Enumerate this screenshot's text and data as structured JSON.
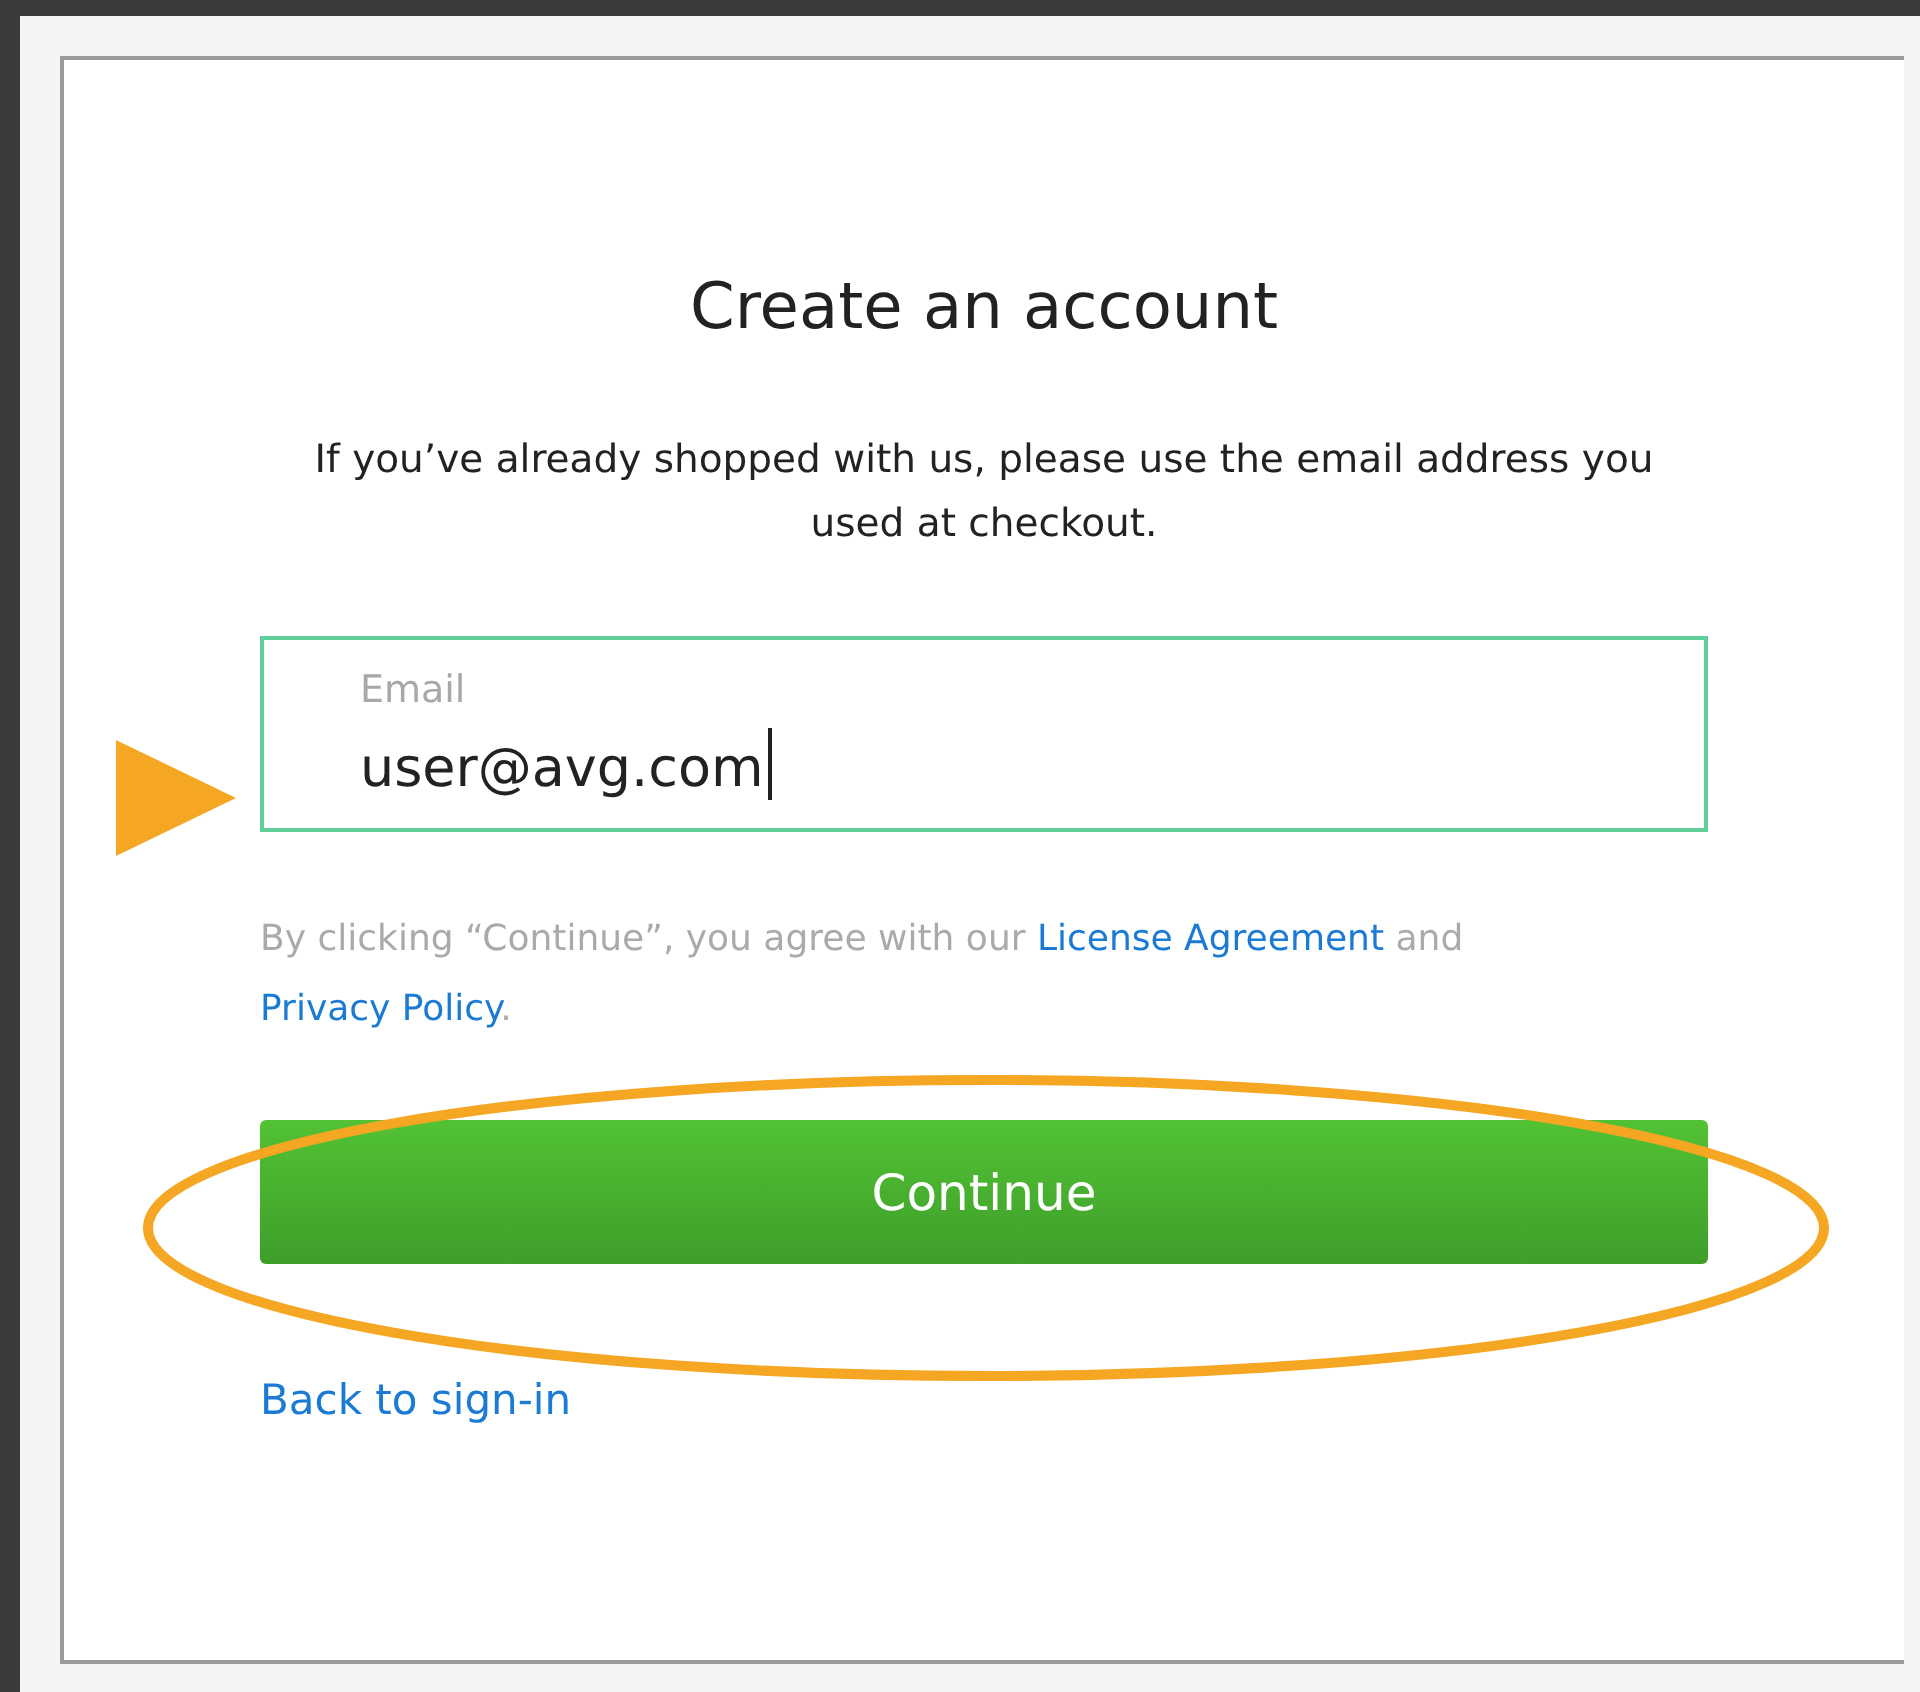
{
  "title": "Create an account",
  "intro": "If you’ve already shopped with us, please use the email address you used at checkout.",
  "email_field": {
    "label": "Email",
    "value": "user@avg.com",
    "focused": true
  },
  "legal": {
    "parts": [
      {
        "kind": "text",
        "text": "By clicking “Continue”, you agree with our "
      },
      {
        "kind": "link",
        "text": "License Agreement"
      },
      {
        "kind": "text",
        "text": " and "
      },
      {
        "kind": "link",
        "text": "Privacy Policy"
      },
      {
        "kind": "text",
        "text": "."
      }
    ]
  },
  "continue_button": "Continue",
  "back_link": "Back to sign-in",
  "pointer_arrow": {
    "color": "#f5a623"
  },
  "highlight_ellipse": {
    "color": "#f5a623"
  }
}
